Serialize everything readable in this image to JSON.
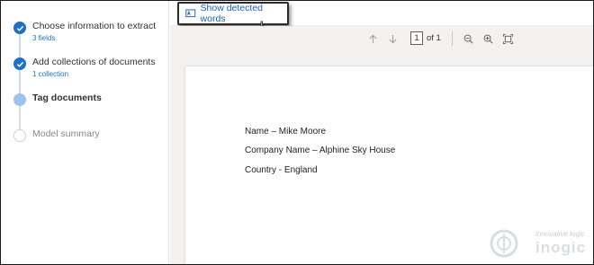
{
  "wizard": {
    "steps": [
      {
        "label": "Choose information to extract",
        "sub": "3 fields",
        "state": "done"
      },
      {
        "label": "Add collections of documents",
        "sub": "1 collection",
        "state": "done"
      },
      {
        "label": "Tag documents",
        "sub": "",
        "state": "current"
      },
      {
        "label": "Model summary",
        "sub": "",
        "state": "todo"
      }
    ]
  },
  "toolbar": {
    "show_words_label": "Show detected words"
  },
  "viewer": {
    "page_current": "1",
    "page_of": "of 1",
    "icons": [
      "arrow-up-icon",
      "arrow-down-icon",
      "zoom-out-icon",
      "zoom-in-icon",
      "fit-page-icon"
    ]
  },
  "document": {
    "lines": [
      "Name – Mike Moore",
      "Company Name – Alphine Sky House",
      "Country - England"
    ]
  },
  "watermark": {
    "tagline": "innovative logic",
    "brand": "inogic"
  },
  "colors": {
    "accent": "#1e70c9",
    "link": "#1a5fb4",
    "viewer_bg": "#f3f2f1"
  }
}
